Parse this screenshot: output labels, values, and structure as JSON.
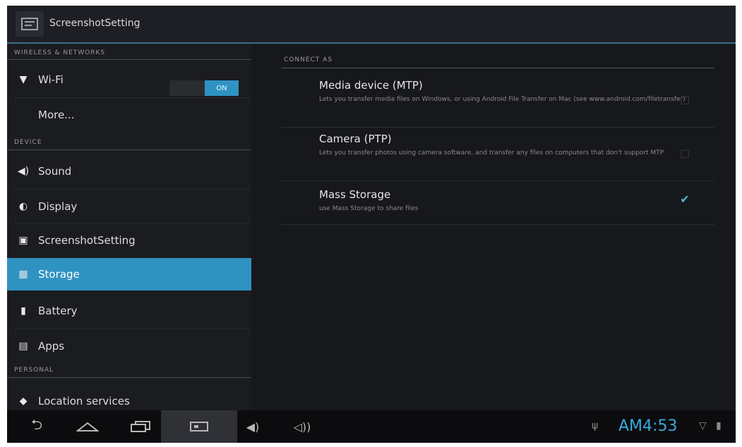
{
  "actionbar": {
    "title": "ScreenshotSetting",
    "icon": "settings-app-icon"
  },
  "sections": {
    "wireless": "WIRELESS & NETWORKS",
    "device": "DEVICE",
    "personal": "PERSONAL"
  },
  "wifi_toggle": "ON",
  "sidebar": {
    "items": [
      {
        "label": "Wi-Fi",
        "icon": "wifi-icon"
      },
      {
        "label": "More...",
        "icon": ""
      },
      {
        "label": "Sound",
        "icon": "sound-icon"
      },
      {
        "label": "Display",
        "icon": "display-icon"
      },
      {
        "label": "ScreenshotSetting",
        "icon": "screenshot-icon"
      },
      {
        "label": "Storage",
        "icon": "storage-icon"
      },
      {
        "label": "Battery",
        "icon": "battery-icon"
      },
      {
        "label": "Apps",
        "icon": "apps-icon"
      },
      {
        "label": "Location services",
        "icon": "location-icon"
      }
    ],
    "selected": "Storage"
  },
  "main": {
    "header": "CONNECT AS",
    "options": [
      {
        "title": "Media device (MTP)",
        "subtitle": "Lets you transfer media files on Windows, or using Android File Transfer on Mac (see www.android.com/filetransfer)",
        "checked": false
      },
      {
        "title": "Camera (PTP)",
        "subtitle": "Lets you transfer photos using camera software, and transfer any files on computers that don't support MTP",
        "checked": false
      },
      {
        "title": "Mass Storage",
        "subtitle": "use Mass Storage to share files",
        "checked": true
      }
    ]
  },
  "navbar": {
    "clock": "AM4:53",
    "buttons": [
      "back",
      "home",
      "recent-apps",
      "screenshot",
      "volume-down",
      "volume-up"
    ]
  },
  "colors": {
    "accent": "#2f93c2",
    "clock": "#3aa9dd",
    "background": "#16171b"
  }
}
